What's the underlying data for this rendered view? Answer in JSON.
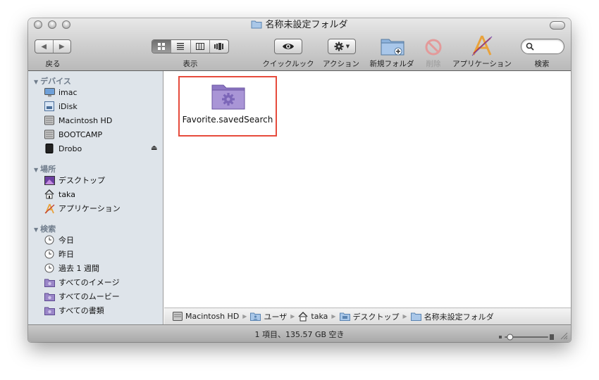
{
  "window": {
    "title": "名称未設定フォルダ"
  },
  "toolbar": {
    "back_label": "戻る",
    "view_label": "表示",
    "quicklook_label": "クイックルック",
    "action_label": "アクション",
    "new_folder_label": "新規フォルダ",
    "delete_label": "削除",
    "applications_label": "アプリケーション",
    "search_label": "検索",
    "view_modes": [
      "icon-view",
      "list-view",
      "column-view",
      "coverflow-view"
    ],
    "selected_view": "icon-view"
  },
  "sidebar": {
    "sections": [
      {
        "title": "デバイス",
        "items": [
          {
            "label": "imac",
            "icon": "imac-icon"
          },
          {
            "label": "iDisk",
            "icon": "idisk-icon"
          },
          {
            "label": "Macintosh HD",
            "icon": "hard-drive-icon"
          },
          {
            "label": "BOOTCAMP",
            "icon": "hard-drive-icon"
          },
          {
            "label": "Drobo",
            "icon": "drobo-icon"
          }
        ]
      },
      {
        "title": "場所",
        "items": [
          {
            "label": "デスクトップ",
            "icon": "desktop-icon"
          },
          {
            "label": "taka",
            "icon": "home-icon"
          },
          {
            "label": "アプリケーション",
            "icon": "applications-icon"
          }
        ]
      },
      {
        "title": "検索",
        "items": [
          {
            "label": "今日",
            "icon": "clock-icon"
          },
          {
            "label": "昨日",
            "icon": "clock-icon"
          },
          {
            "label": "過去 1 週間",
            "icon": "clock-icon"
          },
          {
            "label": "すべてのイメージ",
            "icon": "smart-folder-icon"
          },
          {
            "label": "すべてのムービー",
            "icon": "smart-folder-icon"
          },
          {
            "label": "すべての書類",
            "icon": "smart-folder-icon"
          }
        ]
      }
    ]
  },
  "content": {
    "items": [
      {
        "label": "Favorite.savedSearch",
        "icon": "smart-folder-icon",
        "selected": true
      }
    ]
  },
  "pathbar": {
    "crumbs": [
      {
        "label": "Macintosh HD",
        "icon": "hard-drive-icon"
      },
      {
        "label": "ユーザ",
        "icon": "users-folder-icon"
      },
      {
        "label": "taka",
        "icon": "home-icon"
      },
      {
        "label": "デスクトップ",
        "icon": "desktop-folder-icon"
      },
      {
        "label": "名称未設定フォルダ",
        "icon": "folder-icon"
      }
    ]
  },
  "status": {
    "text": "1 項目、135.57 GB 空き",
    "icon_size_level": 0.1
  },
  "colors": {
    "selection_outline": "#e64b3c",
    "sidebar_bg": "#dee4ea",
    "section_header": "#6f7c8b"
  }
}
